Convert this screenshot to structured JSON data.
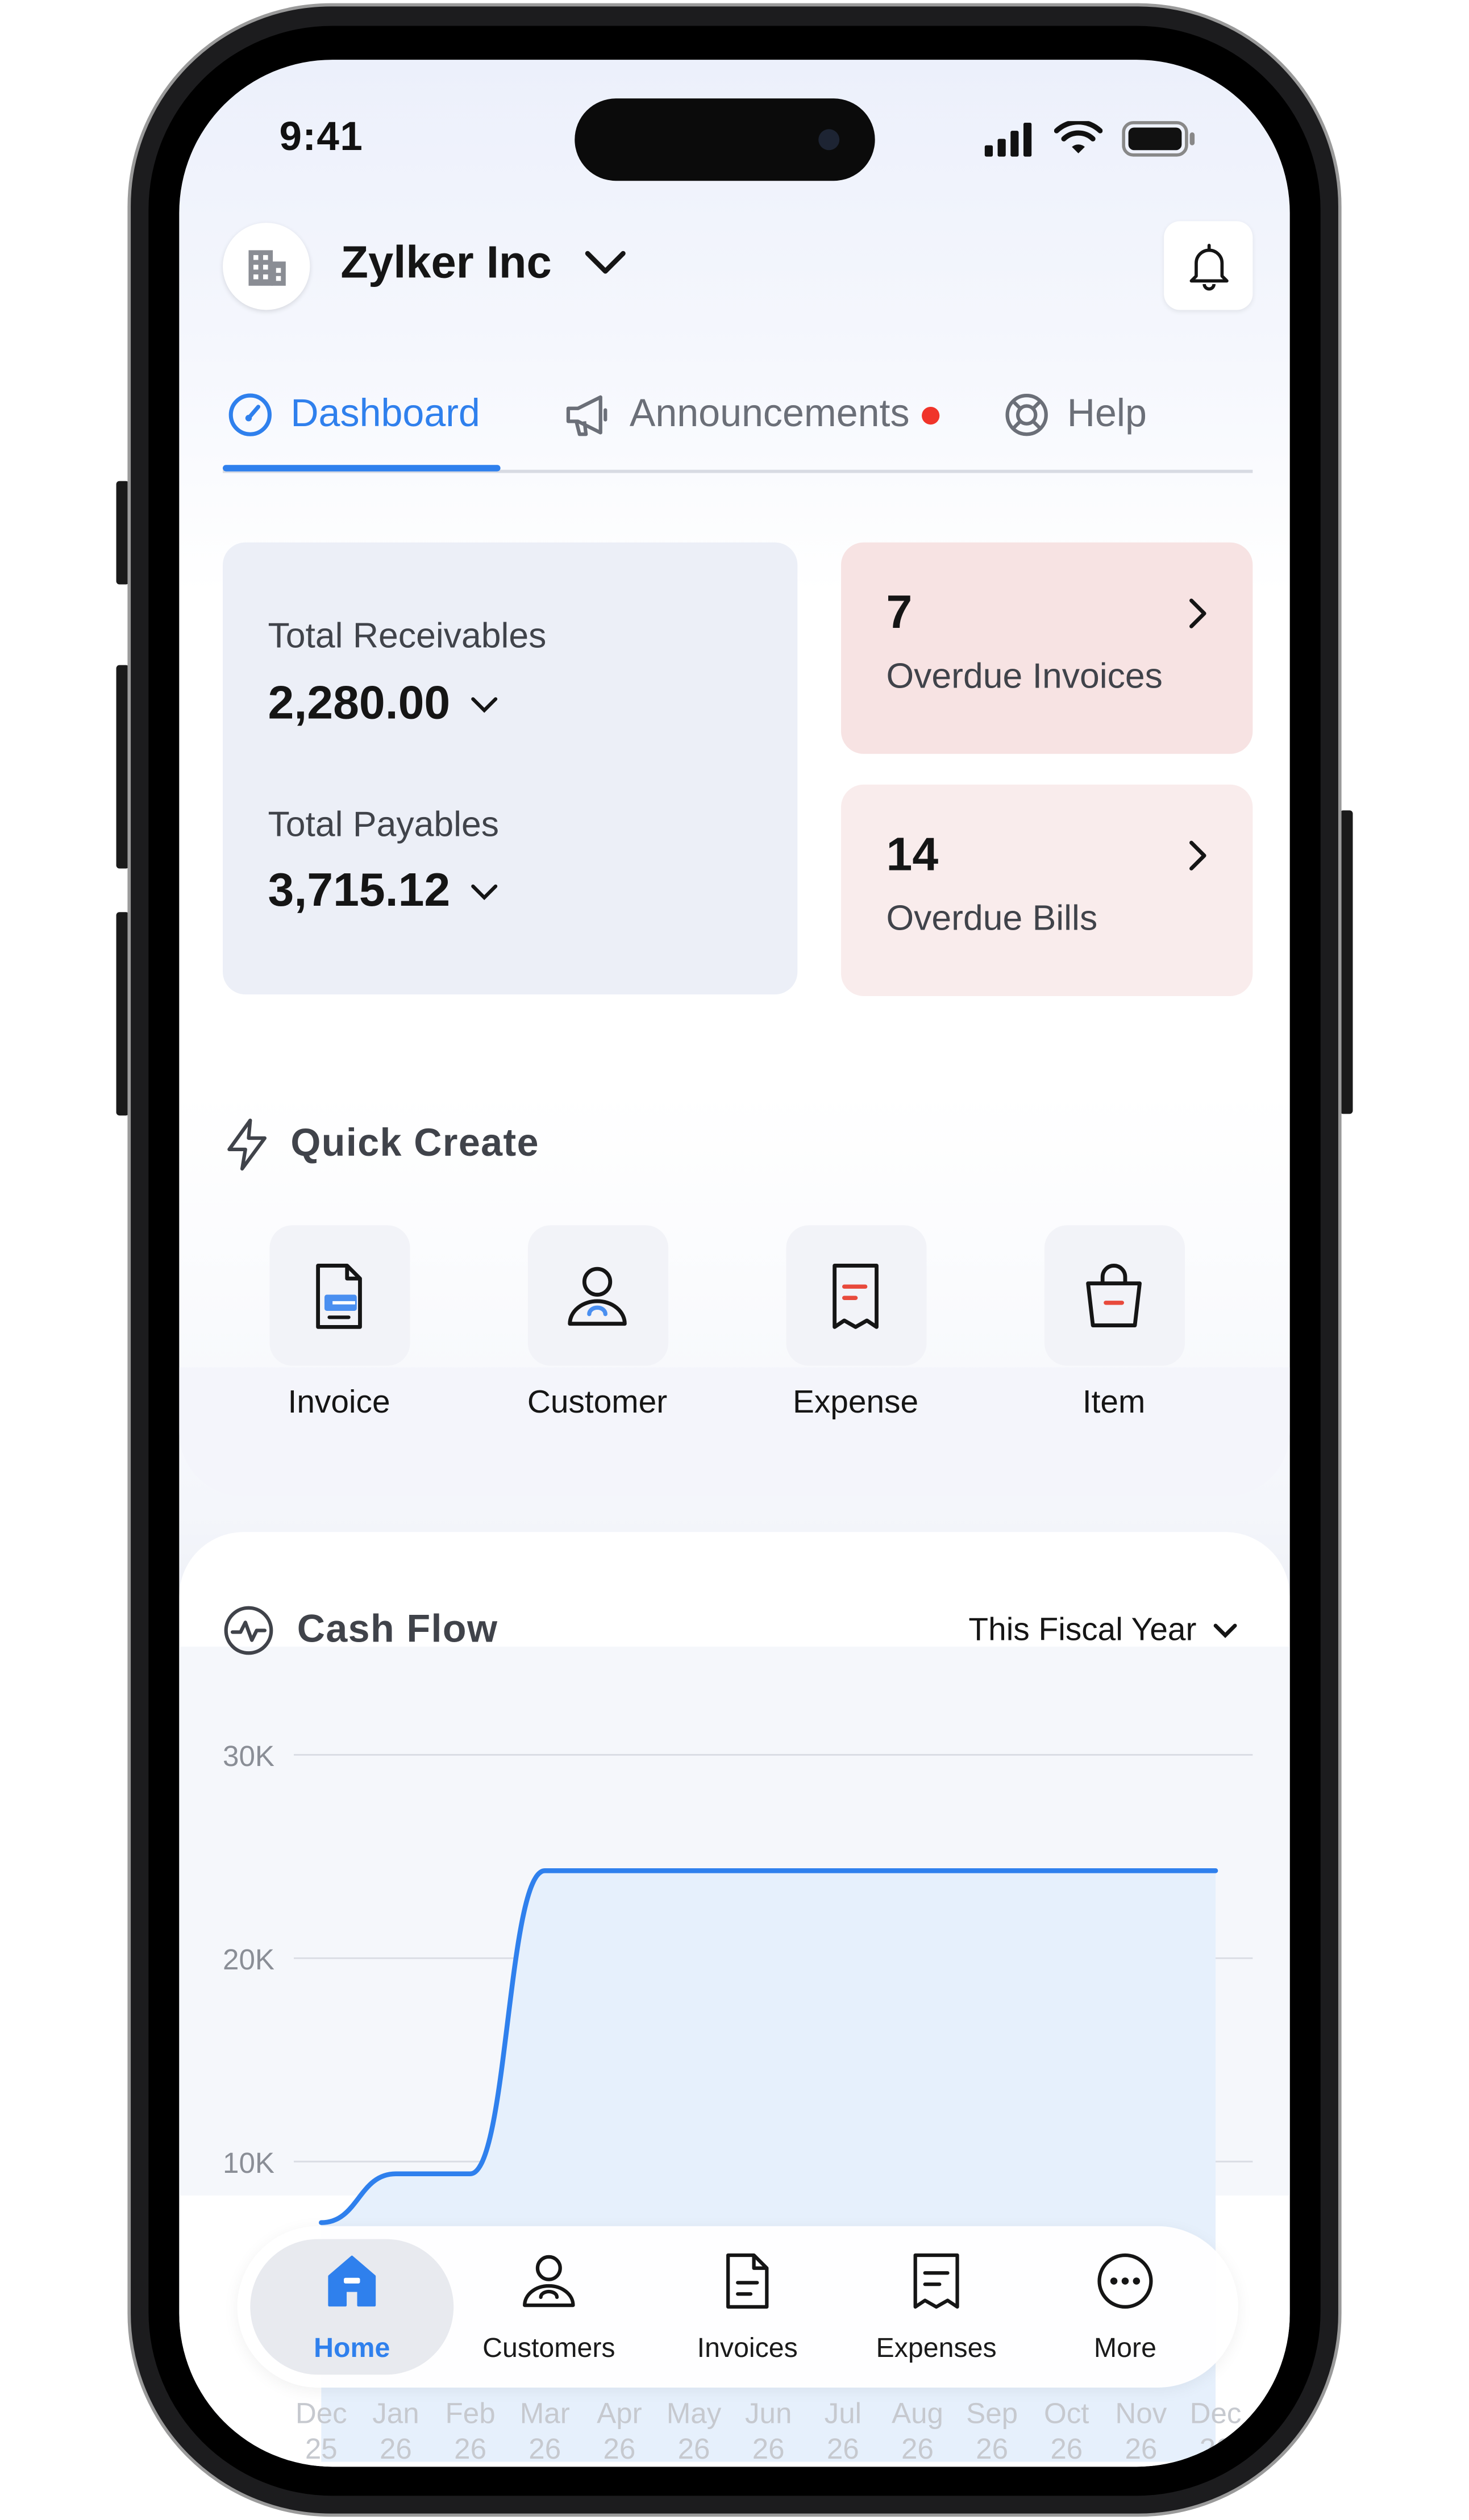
{
  "status_bar": {
    "time": "9:41"
  },
  "header": {
    "org_name": "Zylker Inc"
  },
  "tabs": [
    {
      "label": "Dashboard",
      "active": true
    },
    {
      "label": "Announcements",
      "has_notification_dot": true
    },
    {
      "label": "Help"
    }
  ],
  "summary": {
    "receivables_label": "Total Receivables",
    "receivables_value": "2,280.00",
    "payables_label": "Total Payables",
    "payables_value": "3,715.12"
  },
  "overdue": [
    {
      "count": "7",
      "label": "Overdue Invoices"
    },
    {
      "count": "14",
      "label": "Overdue Bills"
    }
  ],
  "quick_create": {
    "title": "Quick Create",
    "items": [
      {
        "label": "Invoice",
        "icon": "invoice-icon"
      },
      {
        "label": "Customer",
        "icon": "customer-icon"
      },
      {
        "label": "Expense",
        "icon": "expense-icon"
      },
      {
        "label": "Item",
        "icon": "item-bag-icon"
      }
    ]
  },
  "cash_flow": {
    "title": "Cash Flow",
    "range_label": "This Fiscal Year"
  },
  "chart_data": {
    "type": "area",
    "title": "Cash Flow",
    "xlabel": "",
    "ylabel": "",
    "ylim": [
      0,
      30000
    ],
    "yticks": [
      "30K",
      "20K",
      "10K"
    ],
    "categories": [
      "Dec 25",
      "Jan 26",
      "Feb 26",
      "Mar 26",
      "Apr 26",
      "May 26",
      "Jun 26",
      "Jul 26",
      "Aug 26",
      "Sep 26",
      "Oct 26",
      "Nov 26",
      "Dec 26"
    ],
    "category_lines": [
      [
        "Dec",
        "25"
      ],
      [
        "Jan",
        "26"
      ],
      [
        "Feb",
        "26"
      ],
      [
        "Mar",
        "26"
      ],
      [
        "Apr",
        "26"
      ],
      [
        "May",
        "26"
      ],
      [
        "Jun",
        "26"
      ],
      [
        "Jul",
        "26"
      ],
      [
        "Aug",
        "26"
      ],
      [
        "Sep",
        "26"
      ],
      [
        "Oct",
        "26"
      ],
      [
        "Nov",
        "26"
      ],
      [
        "Dec",
        "26"
      ]
    ],
    "values": [
      7000,
      9400,
      9400,
      24300,
      24300,
      24300,
      24300,
      24300,
      24300,
      24300,
      24300,
      24300,
      24300
    ],
    "line_color": "#2f80ed",
    "fill_color": "#e6f0fc",
    "grid": true
  },
  "tab_bar": {
    "items": [
      {
        "label": "Home",
        "icon": "home-icon",
        "active": true
      },
      {
        "label": "Customers",
        "icon": "customers-icon"
      },
      {
        "label": "Invoices",
        "icon": "invoices-icon"
      },
      {
        "label": "Expenses",
        "icon": "expenses-icon"
      },
      {
        "label": "More",
        "icon": "more-icon"
      }
    ]
  },
  "colors": {
    "accent": "#2f80ed",
    "overdue_invoices_bg": "#f7e3e3",
    "overdue_bills_bg": "#f9ecec",
    "alert": "#f0342a"
  }
}
